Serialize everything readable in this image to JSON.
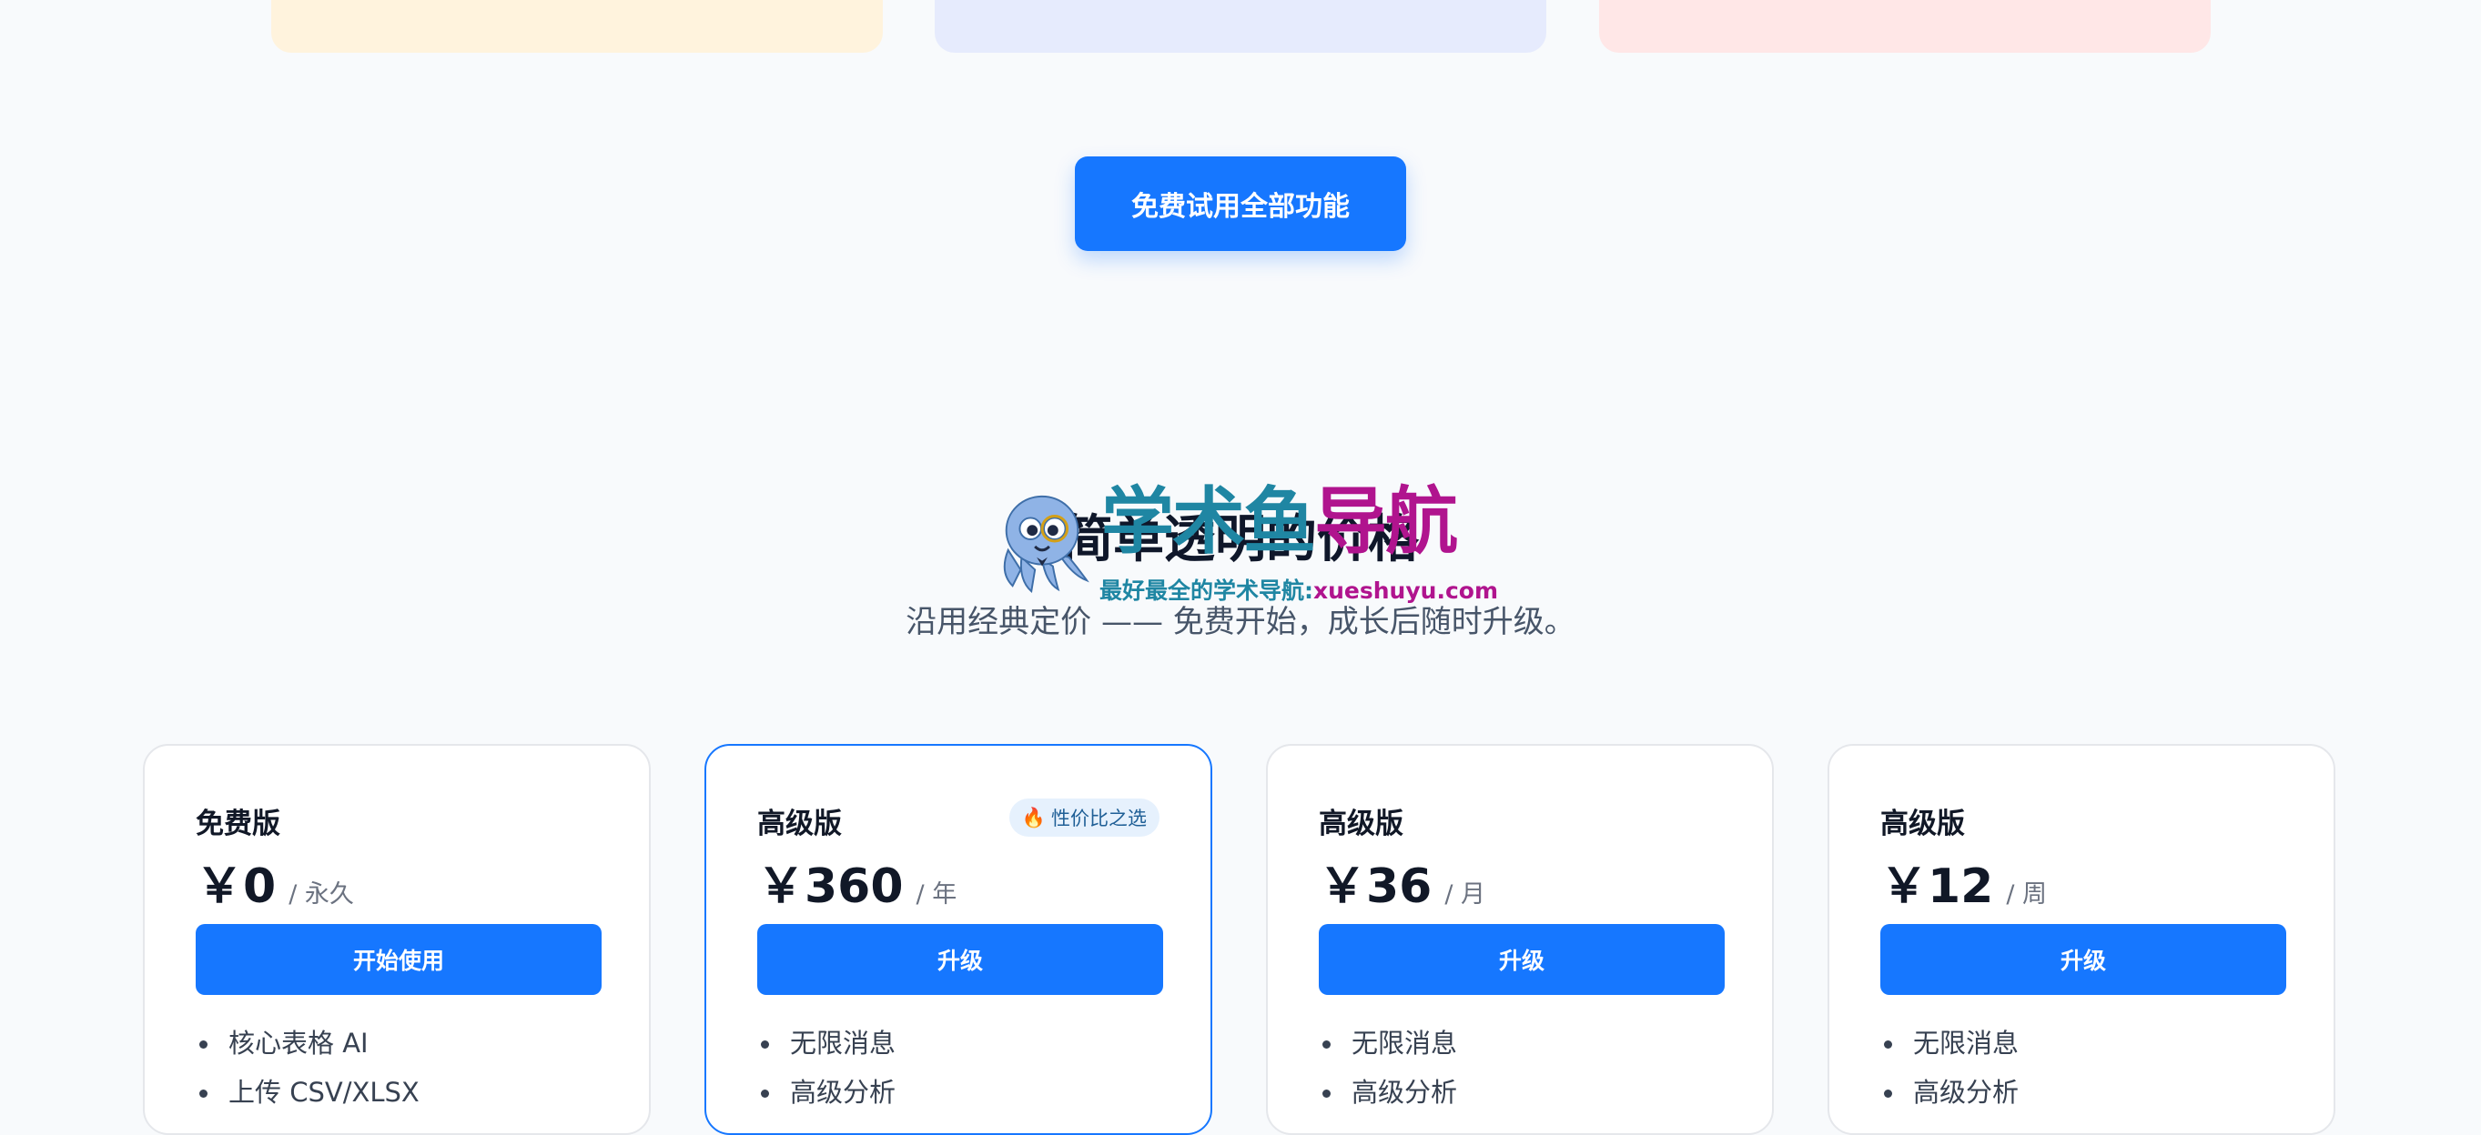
{
  "cta": {
    "label": "免费试用全部功能"
  },
  "pricing": {
    "title": "简单透明的价格",
    "subtitle": "沿用经典定价 —— 免费开始，成长后随时升级。"
  },
  "watermark": {
    "logo_part1": "学术鱼",
    "logo_part2": "导航",
    "slogan_part1": "最好最全的学术导航:",
    "slogan_part2": "xueshuyu.com",
    "icon": "octopus-mascot-icon"
  },
  "plans": [
    {
      "name": "免费版",
      "badge": "",
      "price": "￥0",
      "period": "/ 永久",
      "button": "开始使用",
      "features": [
        "核心表格 AI",
        "上传 CSV/XLSX"
      ]
    },
    {
      "name": "高级版",
      "badge": "性价比之选",
      "badge_icon": "fire-icon",
      "price": "￥360",
      "period": "/ 年",
      "button": "升级",
      "features": [
        "无限消息",
        "高级分析"
      ]
    },
    {
      "name": "高级版",
      "badge": "",
      "price": "￥36",
      "period": "/ 月",
      "button": "升级",
      "features": [
        "无限消息",
        "高级分析"
      ]
    },
    {
      "name": "高级版",
      "badge": "",
      "price": "￥12",
      "period": "/ 周",
      "button": "升级",
      "features": [
        "无限消息",
        "高级分析"
      ]
    }
  ],
  "colors": {
    "accent": "#1677ff",
    "watermark_teal": "#1f86a3",
    "watermark_magenta": "#b0148e"
  }
}
